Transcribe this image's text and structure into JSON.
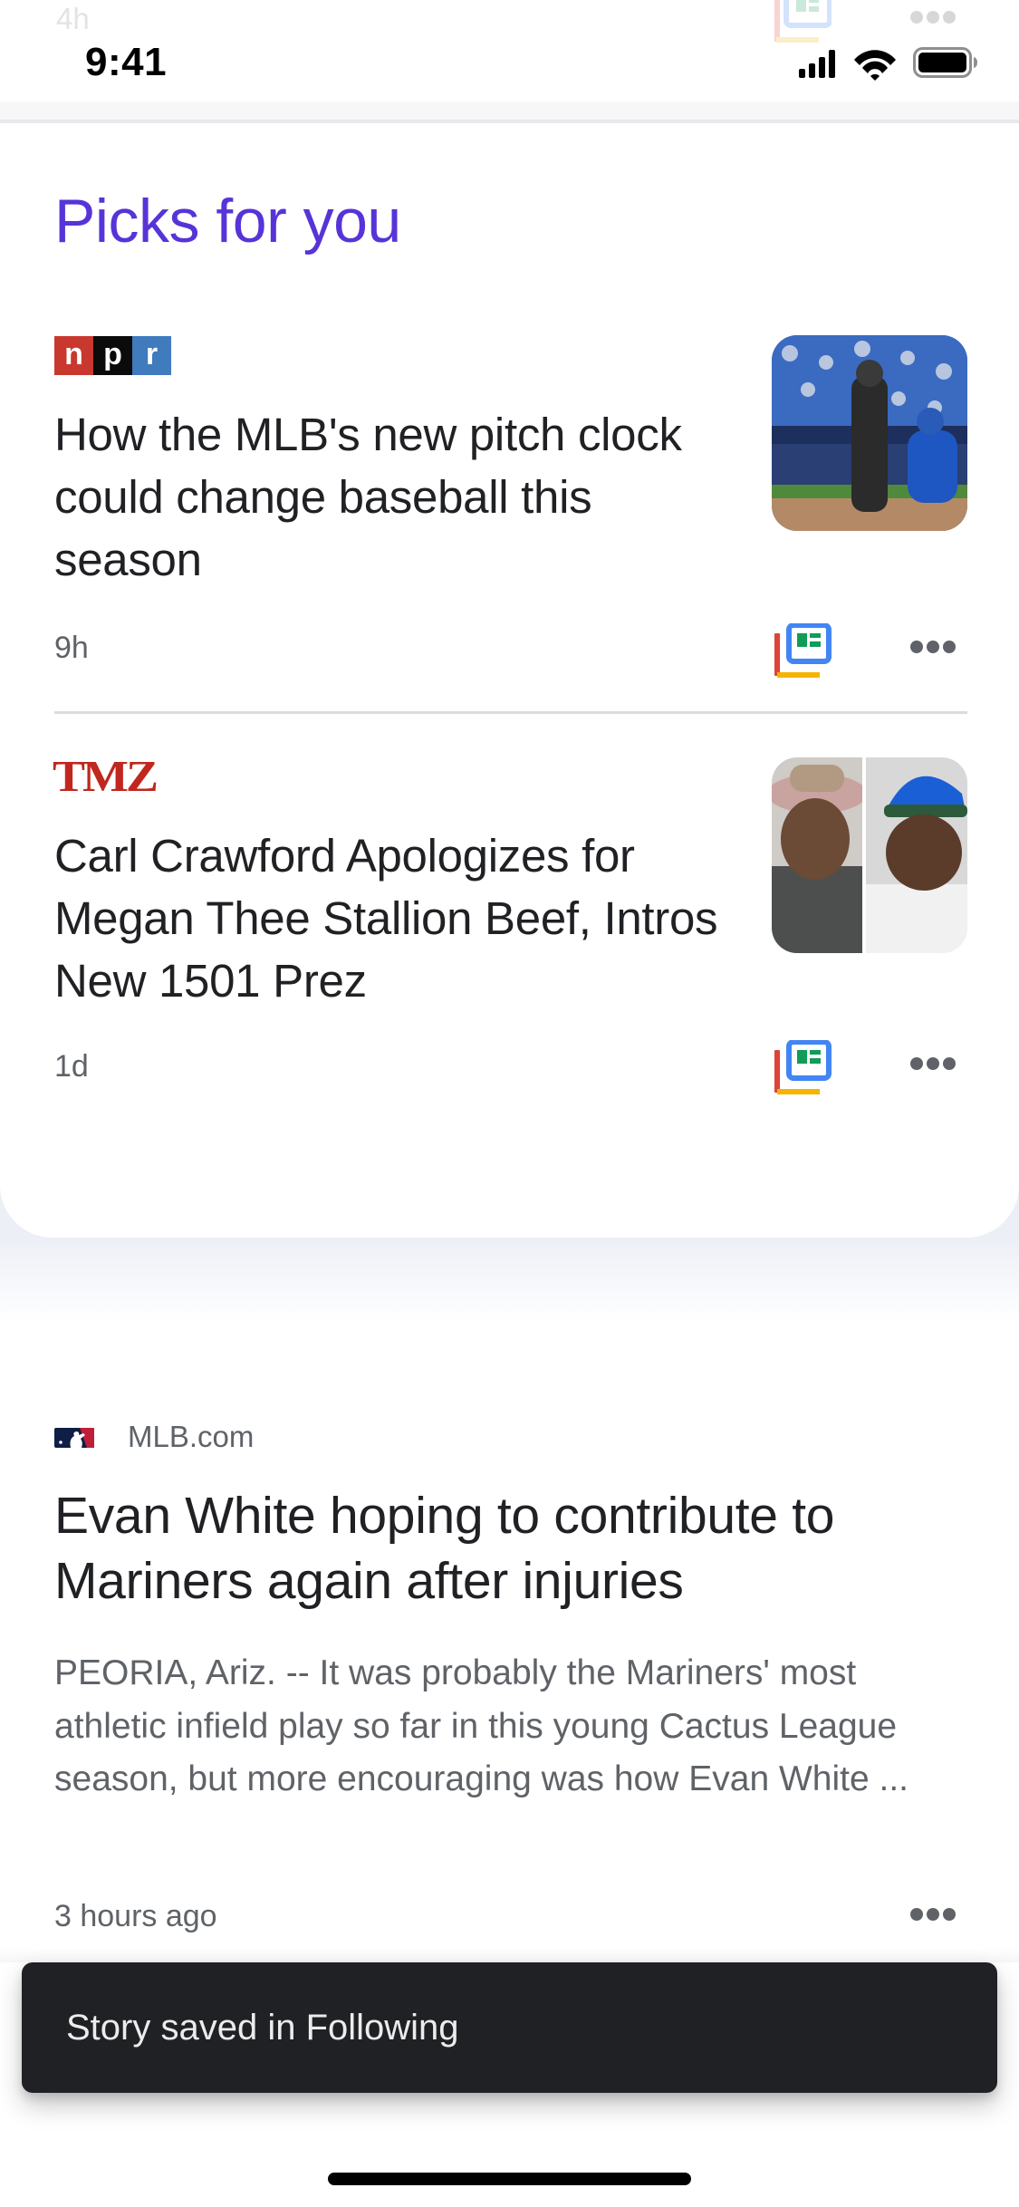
{
  "status_bar": {
    "time": "9:41",
    "icons": [
      "cellular-signal-icon",
      "wifi-icon",
      "battery-icon"
    ]
  },
  "scrolled_under": {
    "timestamp": "4h"
  },
  "picks_section": {
    "title": "Picks for you",
    "accent_color": "#5634d8",
    "articles": [
      {
        "source": "NPR",
        "logo_letters": [
          "n",
          "p",
          "r"
        ],
        "headline": "How the MLB's new pitch clock could change baseball this season",
        "age": "9h",
        "thumbnail": "baseball-umpire-and-catcher-photo",
        "actions": [
          "full-coverage-icon",
          "more-options-icon"
        ]
      },
      {
        "source": "TMZ",
        "logo_text": "TMZ",
        "headline": "Carl Crawford Apologizes for Megan Thee Stallion Beef, Intros New 1501 Prez",
        "age": "1d",
        "thumbnail": "two-men-split-video-photo",
        "actions": [
          "full-coverage-icon",
          "more-options-icon"
        ]
      }
    ]
  },
  "feed_article": {
    "source": "MLB.com",
    "headline": "Evan White hoping to contribute to Mariners again after injuries",
    "snippet": "PEORIA, Ariz. -- It was probably the Mariners' most athletic infield play so far in this young Cactus League season, but more encouraging was how Evan White ...",
    "age": "3 hours ago"
  },
  "snackbar": {
    "message": "Story saved in Following"
  },
  "colors": {
    "npr_red": "#c8382e",
    "npr_blue": "#3f7bbd",
    "tmz_red": "#c0271e",
    "snackbar_bg": "#202124",
    "meta_gray": "#5f6368"
  }
}
